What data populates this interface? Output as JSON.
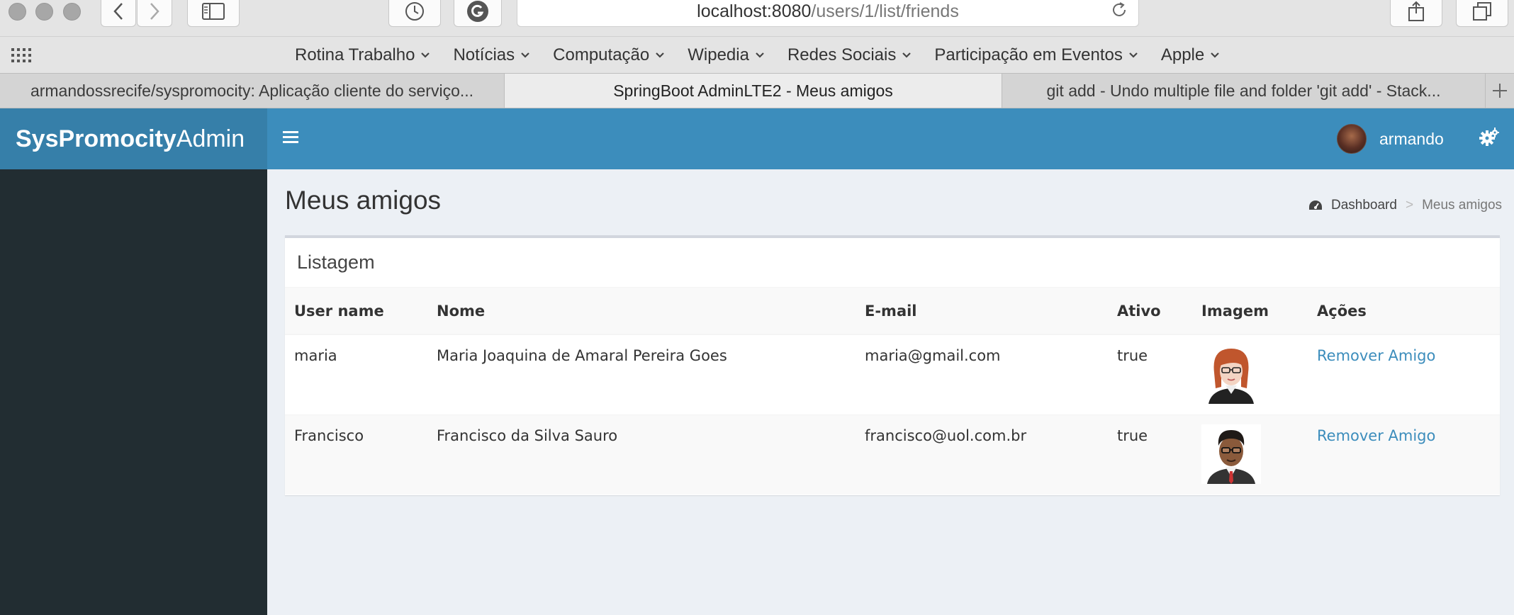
{
  "browser": {
    "url_host": "localhost:8080",
    "url_path": "/users/1/list/friends",
    "bookmarks": [
      {
        "label": "Rotina Trabalho"
      },
      {
        "label": "Notícias"
      },
      {
        "label": "Computação"
      },
      {
        "label": "Wipedia"
      },
      {
        "label": "Redes Sociais"
      },
      {
        "label": "Participação em Eventos"
      },
      {
        "label": "Apple"
      }
    ],
    "tabs": [
      {
        "label": "armandossrecife/syspromocity: Aplicação cliente do serviço..."
      },
      {
        "label": "SpringBoot AdminLTE2 - Meus amigos"
      },
      {
        "label": "git add - Undo multiple file and folder 'git add' - Stack..."
      }
    ]
  },
  "app": {
    "logo_bold": "SysPromocity",
    "logo_light": "Admin",
    "user_name": "armando"
  },
  "page": {
    "title": "Meus amigos",
    "breadcrumb_home": "Dashboard",
    "breadcrumb_sep": ">",
    "breadcrumb_current": "Meus amigos"
  },
  "listing": {
    "title": "Listagem",
    "columns": [
      "User name",
      "Nome",
      "E-mail",
      "Ativo",
      "Imagem",
      "Ações"
    ],
    "rows": [
      {
        "username": "maria",
        "nome": "Maria Joaquina de Amaral Pereira Goes",
        "email": "maria@gmail.com",
        "ativo": "true",
        "image": "female-avatar",
        "action": "Remover Amigo"
      },
      {
        "username": "Francisco",
        "nome": "Francisco da Silva Sauro",
        "email": "francisco@uol.com.br",
        "ativo": "true",
        "image": "male-avatar",
        "action": "Remover Amigo"
      }
    ]
  },
  "colors": {
    "navbar": "#3c8dbc",
    "logo_bg": "#367fa9",
    "sidebar": "#222d32",
    "content_bg": "#ecf0f5",
    "link": "#3c8dbc"
  }
}
